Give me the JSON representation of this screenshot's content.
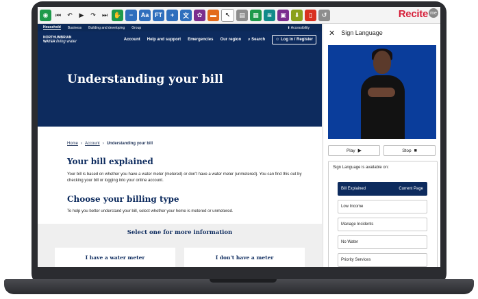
{
  "recite": {
    "logo": "Recite",
    "close_badge": "me",
    "toolbar_buttons": [
      {
        "name": "recite-home-icon",
        "glyph": "◉",
        "style": "green"
      },
      {
        "name": "skip-back-icon",
        "glyph": "⏮",
        "style": "plain"
      },
      {
        "name": "rewind-icon",
        "glyph": "↶",
        "style": "plain"
      },
      {
        "name": "play-icon",
        "glyph": "▶",
        "style": "plain"
      },
      {
        "name": "forward-icon",
        "glyph": "↷",
        "style": "plain"
      },
      {
        "name": "skip-forward-icon",
        "glyph": "⏭",
        "style": "plain"
      },
      {
        "name": "sign-language-icon",
        "glyph": "✋",
        "style": "green"
      },
      {
        "name": "decrease-text-icon",
        "glyph": "−",
        "style": "blue"
      },
      {
        "name": "font-size-icon",
        "glyph": "Aa",
        "style": "blue"
      },
      {
        "name": "font-type-icon",
        "glyph": "FT",
        "style": "blue"
      },
      {
        "name": "increase-text-icon",
        "glyph": "+",
        "style": "blue"
      },
      {
        "name": "translate-icon",
        "glyph": "文",
        "style": "blue"
      },
      {
        "name": "color-palette-icon",
        "glyph": "✿",
        "style": "purple"
      },
      {
        "name": "ruler-icon",
        "glyph": "▬",
        "style": "orange"
      },
      {
        "name": "cursor-icon",
        "glyph": "↖",
        "style": "white"
      },
      {
        "name": "reading-mask-icon",
        "glyph": "▤",
        "style": "gray"
      },
      {
        "name": "margins-icon",
        "glyph": "▦",
        "style": "green"
      },
      {
        "name": "layers-icon",
        "glyph": "≋",
        "style": "teal"
      },
      {
        "name": "dictionary-icon",
        "glyph": "▣",
        "style": "purple"
      },
      {
        "name": "download-icon",
        "glyph": "⬇",
        "style": "olive"
      },
      {
        "name": "pdf-icon",
        "glyph": "▯",
        "style": "red"
      },
      {
        "name": "reset-icon",
        "glyph": "↺",
        "style": "gray"
      }
    ]
  },
  "site": {
    "top_links": [
      "Household",
      "Business",
      "Building and developing",
      "Group"
    ],
    "accessibility": "Accessibility",
    "logo_line1": "NORTHUMBRIAN",
    "logo_line2": "WATER",
    "logo_tagline": "living water",
    "nav_links": [
      "Account",
      "Help and support",
      "Emergencies",
      "Our region"
    ],
    "search_label": "Search",
    "login_label": "Log in / Register",
    "hero_title": "Understanding your bill",
    "breadcrumb": [
      "Home",
      "Account",
      "Understanding your bill"
    ],
    "section1_title": "Your bill explained",
    "section1_text": "Your bill is based on whether you have a water meter (metered) or don't have a water meter (unmetered). You can find this out by checking your bill or logging into your online account.",
    "section2_title": "Choose your billing type",
    "section2_text": "To help you better understand your bill, select whether your home is metered or unmetered.",
    "select_title": "Select one for more information",
    "card_metered": "I have a water meter",
    "card_unmetered": "I don't have a meter"
  },
  "sign_panel": {
    "title": "Sign Language",
    "play_label": "Play",
    "stop_label": "Stop",
    "available_title": "Sign Language is available on:",
    "active_item": "Bill Explained",
    "active_badge": "Current Page",
    "items": [
      "Low Income",
      "Manage Incidents",
      "No Water",
      "Priority Services"
    ]
  }
}
